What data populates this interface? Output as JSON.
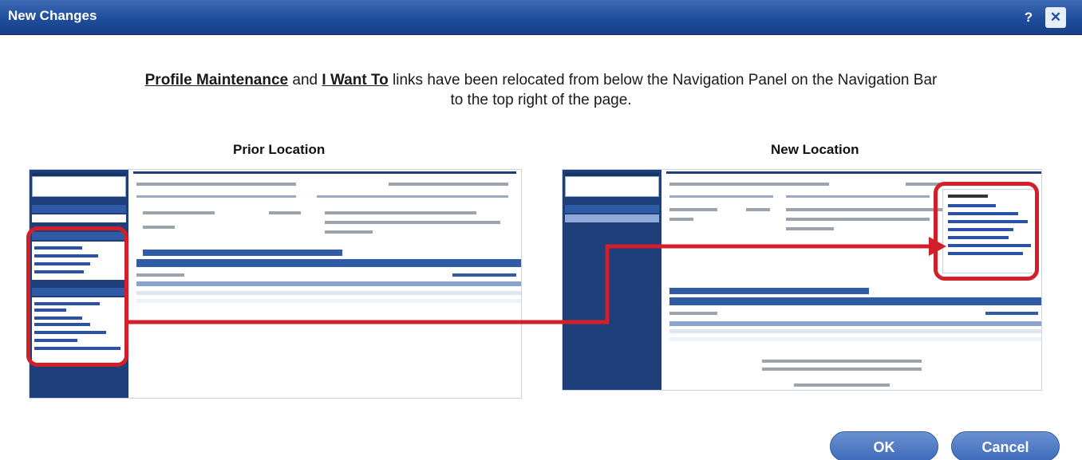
{
  "window": {
    "title": "New Changes",
    "help_label": "?",
    "close_label": "✕"
  },
  "headline": {
    "link1": "Profile Maintenance",
    "text1": " and ",
    "link2": "I Want To",
    "text2": " links have been relocated from below the Navigation Panel on the Navigation Bar",
    "line2": "to the top right of the page."
  },
  "sections": {
    "prior_label": "Prior Location",
    "new_label": "New Location"
  },
  "buttons": {
    "ok": "OK",
    "cancel": "Cancel"
  },
  "colors": {
    "titlebar": "#1f4e9b",
    "highlight": "#d21f2a",
    "button": "#4a77c4",
    "sidebar": "#1f3f7a"
  }
}
